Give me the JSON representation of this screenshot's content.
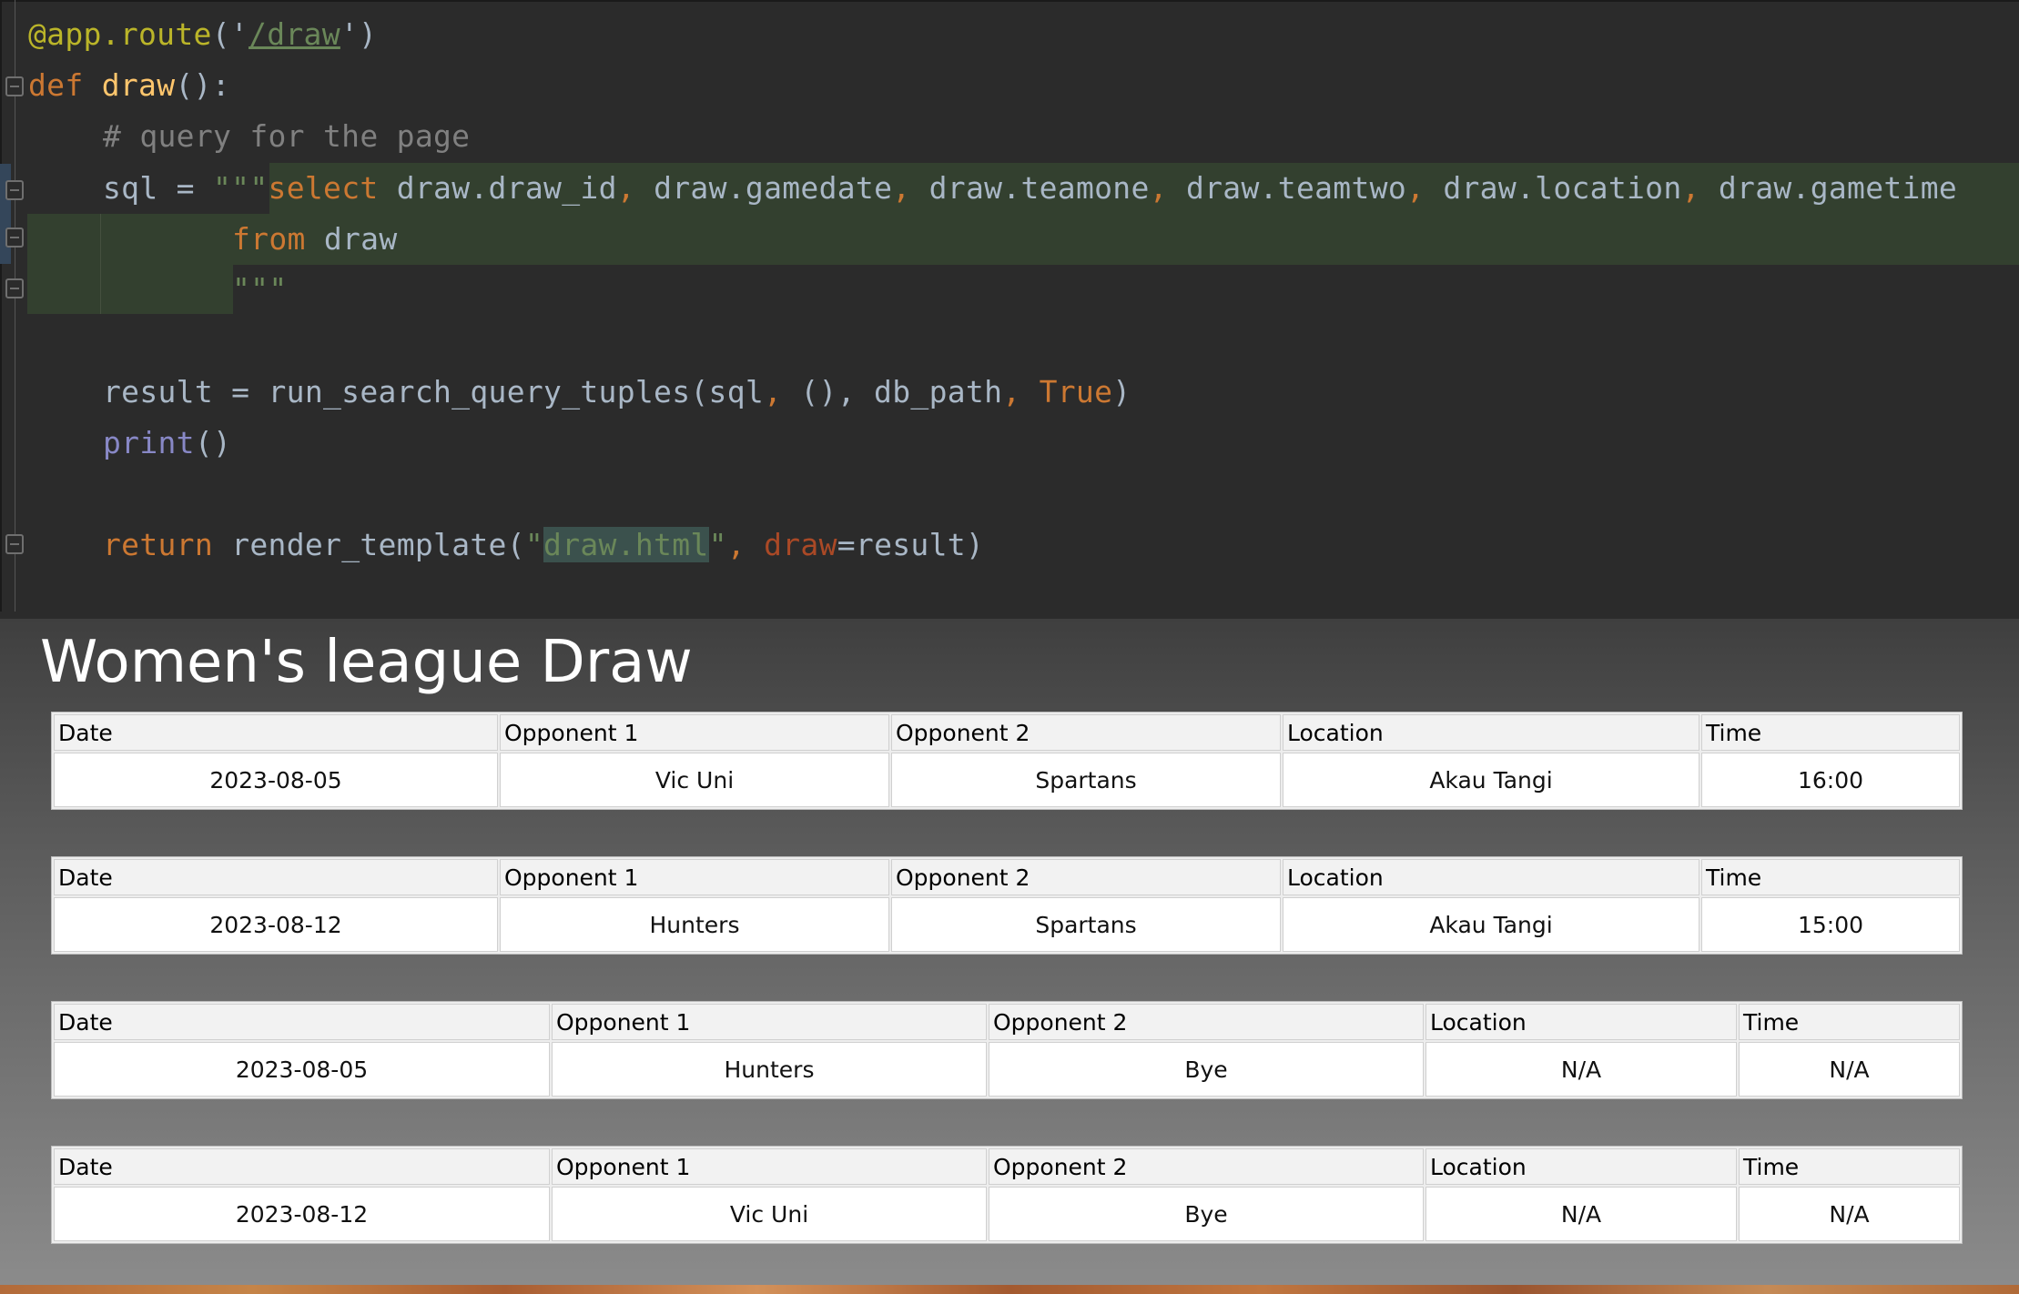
{
  "editor": {
    "decorator": {
      "name": "@app.route",
      "open": "('",
      "route": "/draw",
      "close": "')"
    },
    "def_line": {
      "keyword": "def",
      "func": "draw",
      "rest": "():"
    },
    "comment": "# query for the page",
    "sql_line": {
      "lhs": "sql = ",
      "quotes": "\"\"\"",
      "select": "select",
      "cols": [
        "draw.draw_id",
        "draw.gamedate",
        "draw.teamone",
        "draw.teamtwo",
        "draw.location",
        "draw.gametime"
      ]
    },
    "from_line": {
      "keyword": "from",
      "table": "draw"
    },
    "close_quotes": "\"\"\"",
    "result_line": {
      "lhs": "result = run_search_query_tuples(sql",
      "args": "(), db_path",
      "true": "True",
      "end": ")"
    },
    "print_line": {
      "builtin": "print",
      "args": "()"
    },
    "return_line": {
      "keyword": "return",
      "call": "render_template(",
      "q1": "\"",
      "template": "draw.html",
      "q2": "\"",
      "param": "draw",
      "value": "=result)"
    }
  },
  "page": {
    "title": "Women's league Draw",
    "headers": [
      "Date",
      "Opponent 1",
      "Opponent 2",
      "Location",
      "Time"
    ],
    "games": [
      {
        "date": "2023-08-05",
        "team1": "Vic Uni",
        "team2": "Spartans",
        "location": "Akau Tangi",
        "time": "16:00"
      },
      {
        "date": "2023-08-12",
        "team1": "Hunters",
        "team2": "Spartans",
        "location": "Akau Tangi",
        "time": "15:00"
      },
      {
        "date": "2023-08-05",
        "team1": "Hunters",
        "team2": "Bye",
        "location": "N/A",
        "time": "N/A"
      },
      {
        "date": "2023-08-12",
        "team1": "Vic Uni",
        "team2": "Bye",
        "location": "N/A",
        "time": "N/A"
      }
    ]
  }
}
